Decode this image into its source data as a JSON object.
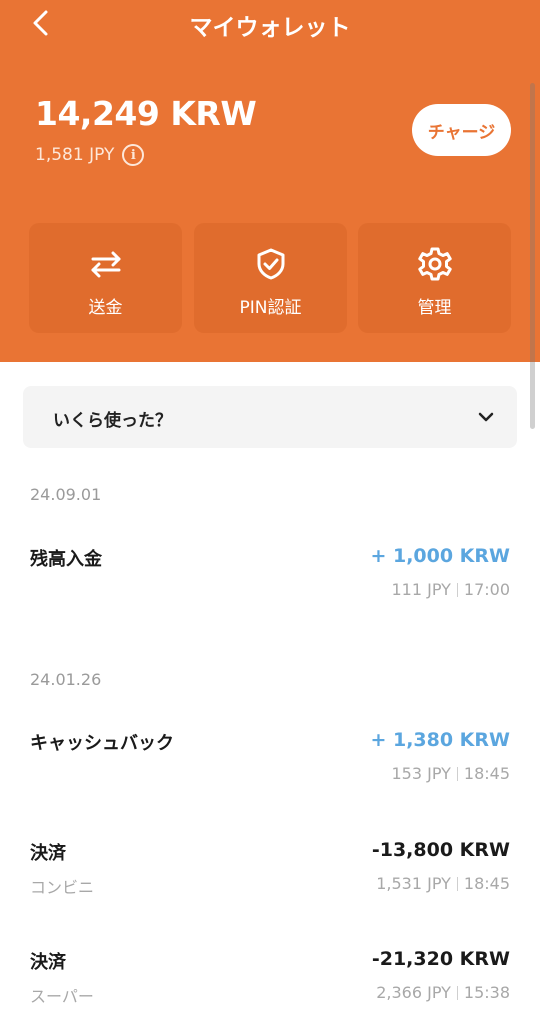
{
  "header": {
    "title": "マイウォレット",
    "balance": "14,249 KRW",
    "balance_sub": "1,581 JPY",
    "charge_label": "チャージ",
    "brand_color": "#e97434"
  },
  "actions": [
    {
      "label": "送金",
      "icon": "transfer-arrows-icon"
    },
    {
      "label": "PIN認証",
      "icon": "shield-check-icon"
    },
    {
      "label": "管理",
      "icon": "gear-icon"
    }
  ],
  "filter": {
    "label": "いくら使った？"
  },
  "groups": [
    {
      "date": "24.09.01",
      "items": [
        {
          "title": "残高入金",
          "sub": "",
          "amount": "+ 1,000 KRW",
          "jpy": "111 JPY",
          "time": "17:00",
          "sign": "plus"
        }
      ]
    },
    {
      "date": "24.01.26",
      "items": [
        {
          "title": "キャッシュバック",
          "sub": "",
          "amount": "+ 1,380 KRW",
          "jpy": "153 JPY",
          "time": "18:45",
          "sign": "plus"
        },
        {
          "title": "決済",
          "sub": "コンビニ",
          "amount": "-13,800 KRW",
          "jpy": "1,531 JPY",
          "time": "18:45",
          "sign": "minus"
        },
        {
          "title": "決済",
          "sub": "スーパー",
          "amount": "-21,320 KRW",
          "jpy": "2,366 JPY",
          "time": "15:38",
          "sign": "minus"
        }
      ]
    }
  ],
  "colors": {
    "plus": "#5ba6df",
    "minus": "#1a1a1a"
  }
}
